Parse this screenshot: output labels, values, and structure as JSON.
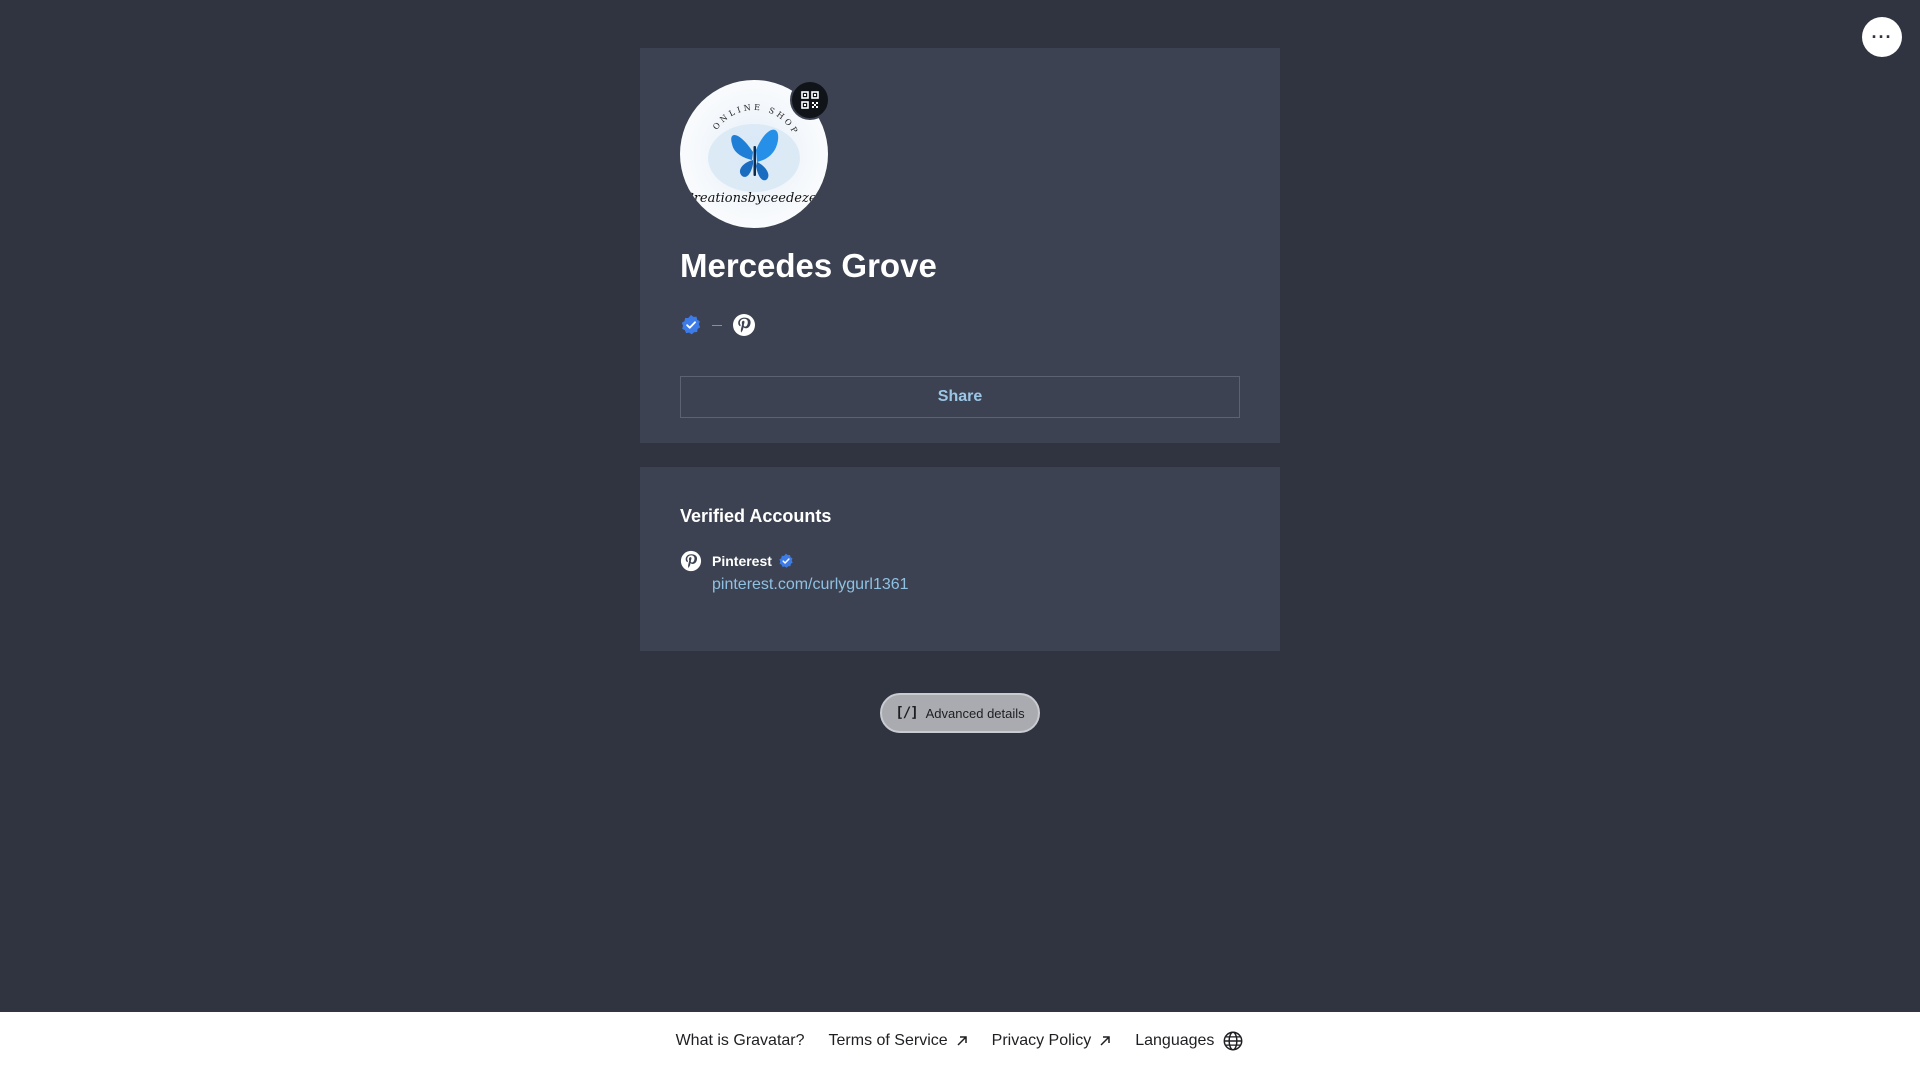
{
  "header": {
    "more_icon": "more-horizontal-icon",
    "more_glyph": "···"
  },
  "profile": {
    "avatar_text_top": "ONLINE SHOP",
    "avatar_text_script": "Creationsbyceedezee",
    "qr_icon": "qr-code-icon",
    "name": "Mercedes Grove",
    "badges": [
      "verified-badge-icon",
      "pinterest-icon"
    ],
    "share_label": "Share"
  },
  "verified_accounts": {
    "title": "Verified Accounts",
    "items": [
      {
        "icon": "pinterest-icon",
        "name": "Pinterest",
        "verified_icon": "verified-badge-icon",
        "url": "pinterest.com/curlygurl1361"
      }
    ]
  },
  "advanced": {
    "icon_glyph": "[/]",
    "label": "Advanced details"
  },
  "footer": {
    "links": [
      {
        "label": "What is Gravatar?",
        "icon": ""
      },
      {
        "label": "Terms of Service",
        "icon": "external-arrow-icon"
      },
      {
        "label": "Privacy Policy",
        "icon": "external-arrow-icon"
      },
      {
        "label": "Languages",
        "icon": "globe-icon"
      }
    ]
  },
  "colors": {
    "background": "#2f3440",
    "card": "#3c4251",
    "accent_link": "#8fc1e3",
    "verified_blue": "#3d7ce8"
  }
}
